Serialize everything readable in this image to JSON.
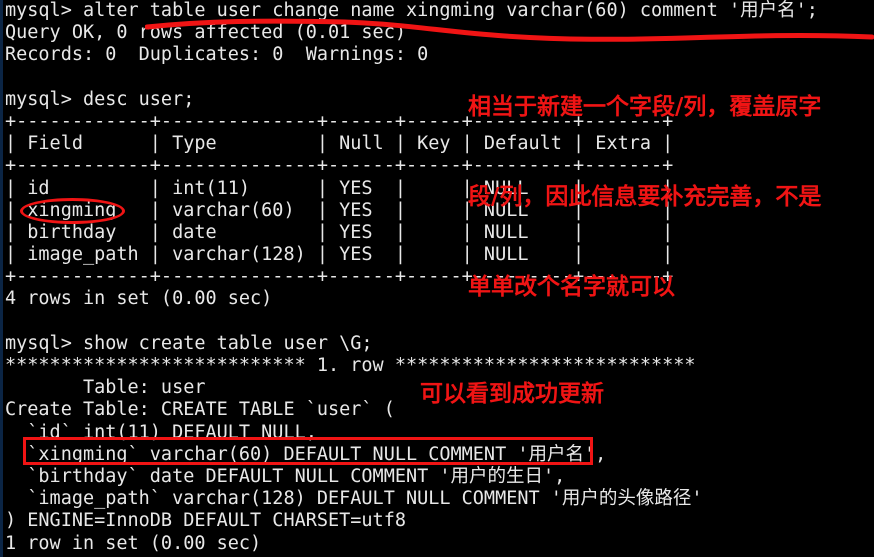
{
  "terminal": {
    "background": "#000000",
    "foreground": "#e8e8e8",
    "annotation_color": "#f01414",
    "lines": [
      "mysql> alter table user change name xingming varchar(60) comment '用户名';",
      "Query OK, 0 rows affected (0.01 sec)",
      "Records: 0  Duplicates: 0  Warnings: 0",
      "",
      "mysql> desc user;",
      "+------------+--------------+------+-----+---------+-------+",
      "| Field      | Type         | Null | Key | Default | Extra |",
      "+------------+--------------+------+-----+---------+-------+",
      "| id         | int(11)      | YES  |     | NULL    |       |",
      "| xingming   | varchar(60)  | YES  |     | NULL    |       |",
      "| birthday   | date         | YES  |     | NULL    |       |",
      "| image_path | varchar(128) | YES  |     | NULL    |       |",
      "+------------+--------------+------+-----+---------+-------+",
      "4 rows in set (0.00 sec)",
      "",
      "mysql> show create table user \\G;",
      "*************************** 1. row ***************************",
      "       Table: user",
      "Create Table: CREATE TABLE `user` (",
      "  `id` int(11) DEFAULT NULL,",
      "  `xingming` varchar(60) DEFAULT NULL COMMENT '用户名',",
      "  `birthday` date DEFAULT NULL COMMENT '用户的生日',",
      "  `image_path` varchar(128) DEFAULT NULL COMMENT '用户的头像路径'",
      ") ENGINE=InnoDB DEFAULT CHARSET=utf8",
      "1 row in set (0.00 sec)"
    ]
  },
  "annotations": {
    "main_note_lines": [
      "相当于新建一个字段/列，覆盖原字",
      "段/列，因此信息要补充完善，不是",
      "单单改个名字就可以"
    ],
    "update_note": "可以看到成功更新",
    "highlight_ellipse_target": "xingming",
    "highlight_rect_target": "`xingming` varchar(60) DEFAULT NULL COMMENT '用户名',",
    "underline_target": "alter table user change name xingming varchar(60) comment '用户名';"
  }
}
